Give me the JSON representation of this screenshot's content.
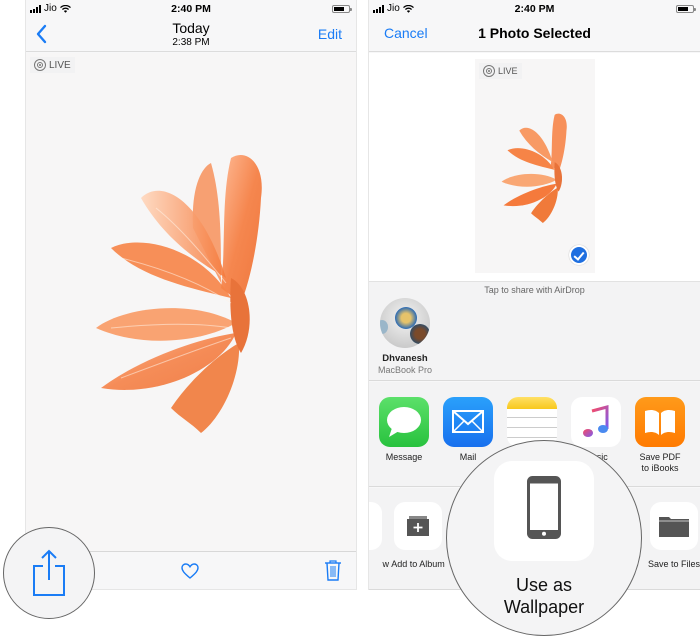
{
  "left_screen": {
    "status_bar": {
      "carrier": "Jio",
      "time": "2:40 PM",
      "signal_icon": "signal-bars-icon",
      "wifi_icon": "wifi-icon",
      "battery_icon": "battery-icon"
    },
    "nav": {
      "back_icon": "chevron-left-icon",
      "title": "Today",
      "subtitle": "2:38 PM",
      "edit_label": "Edit"
    },
    "photo": {
      "live_label": "LIVE",
      "subject": "orange betta fish"
    },
    "toolbar": {
      "share_icon": "share-icon",
      "favorite_icon": "heart-icon",
      "delete_icon": "trash-icon"
    }
  },
  "right_screen": {
    "status_bar": {
      "carrier": "Jio",
      "time": "2:40 PM"
    },
    "nav": {
      "cancel_label": "Cancel",
      "title": "1 Photo Selected"
    },
    "preview": {
      "live_label": "LIVE",
      "selected": true
    },
    "airdrop": {
      "hint": "Tap to share with AirDrop",
      "devices": [
        {
          "name": "Dhvanesh",
          "type": "MacBook Pro"
        }
      ]
    },
    "apps": [
      {
        "label": "Message",
        "icon": "messages-icon",
        "color": "#34c759"
      },
      {
        "label": "Mail",
        "icon": "mail-icon",
        "color": "#1a8cf5"
      },
      {
        "label": "Notes",
        "icon": "notes-icon",
        "color": "#ffcc00"
      },
      {
        "label": "Music",
        "icon": "music-icon",
        "color": "#fc3c63"
      },
      {
        "label": "Save PDF\nto iBooks",
        "label_line1": "Save PDF",
        "label_line2": "to iBooks",
        "icon": "ibooks-icon",
        "color": "#ff8200"
      }
    ],
    "actions": [
      {
        "label": "Slideshow",
        "visible_label": "w",
        "icon": "slideshow-icon"
      },
      {
        "label": "Add to Album",
        "icon": "add-to-album-icon"
      },
      {
        "label": "Use as Wallpaper",
        "icon": "wallpaper-icon"
      },
      {
        "label": "Save to Files",
        "icon": "folder-icon"
      }
    ],
    "magnifier": {
      "line1": "Use as",
      "line2": "Wallpaper"
    }
  },
  "colors": {
    "accent": "#1a7cf5",
    "checkmark": "#1f6fe0",
    "background": "#f7f7f8"
  }
}
